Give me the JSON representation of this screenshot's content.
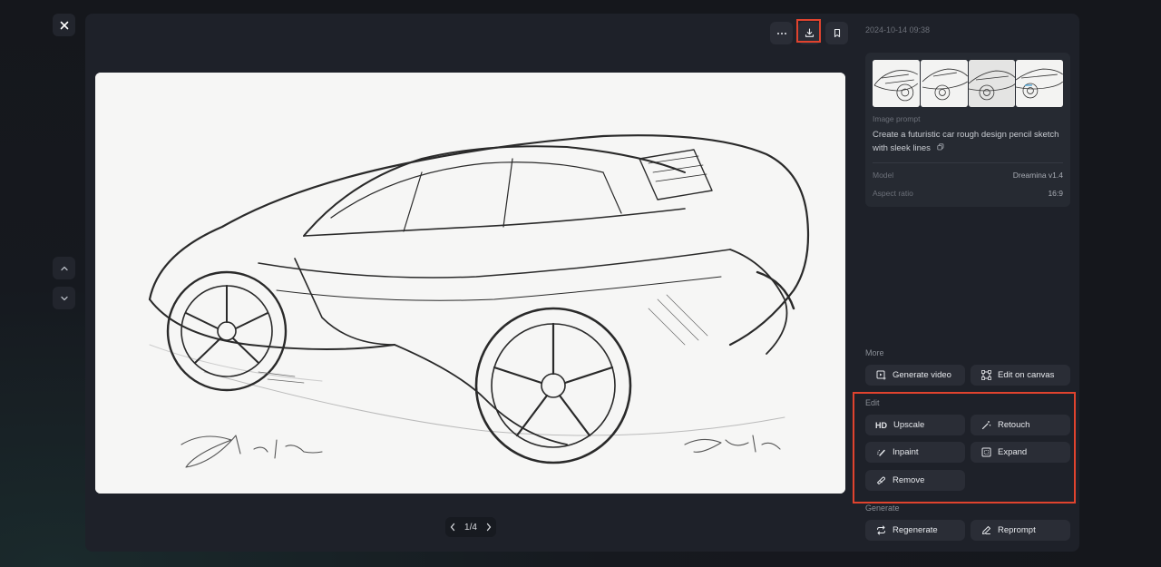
{
  "toolbar": {
    "close_icon": "close-icon",
    "more_icon": "more-horizontal-icon",
    "download_icon": "download-icon",
    "bookmark_icon": "bookmark-icon",
    "prev_icon": "chevron-up-icon",
    "next_icon": "chevron-down-icon"
  },
  "pager": {
    "text": "1/4",
    "current": 1,
    "total": 4
  },
  "info": {
    "timestamp": "2024-10-14 09:38",
    "prompt_label": "Image prompt",
    "prompt": "Create a futuristic car rough design pencil sketch with sleek lines",
    "model_label": "Model",
    "model": "Dreamina v1.4",
    "aspect_label": "Aspect ratio",
    "aspect": "16:9",
    "thumbnails": [
      "Variation 1",
      "Variation 2",
      "Variation 3",
      "Variation 4"
    ]
  },
  "image": {
    "description": "Pencil sketch of a futuristic sports car",
    "signature_left": "signature",
    "signature_right": "signature"
  },
  "sections": {
    "more": {
      "label": "More",
      "buttons": [
        {
          "label": "Generate video",
          "icon": "video-add-icon"
        },
        {
          "label": "Edit on canvas",
          "icon": "canvas-icon"
        }
      ]
    },
    "edit": {
      "label": "Edit",
      "buttons": [
        {
          "label": "Upscale",
          "icon": "HD"
        },
        {
          "label": "Retouch",
          "icon": "magic-wand-icon"
        },
        {
          "label": "Inpaint",
          "icon": "inpaint-brush-icon"
        },
        {
          "label": "Expand",
          "icon": "expand-icon"
        },
        {
          "label": "Remove",
          "icon": "eraser-icon"
        }
      ]
    },
    "generate": {
      "label": "Generate",
      "buttons": [
        {
          "label": "Regenerate",
          "icon": "refresh-icon"
        },
        {
          "label": "Reprompt",
          "icon": "pencil-icon"
        }
      ]
    }
  },
  "colors": {
    "highlight": "#e0432e",
    "panel": "#1e2129",
    "button": "#2a2d36"
  }
}
